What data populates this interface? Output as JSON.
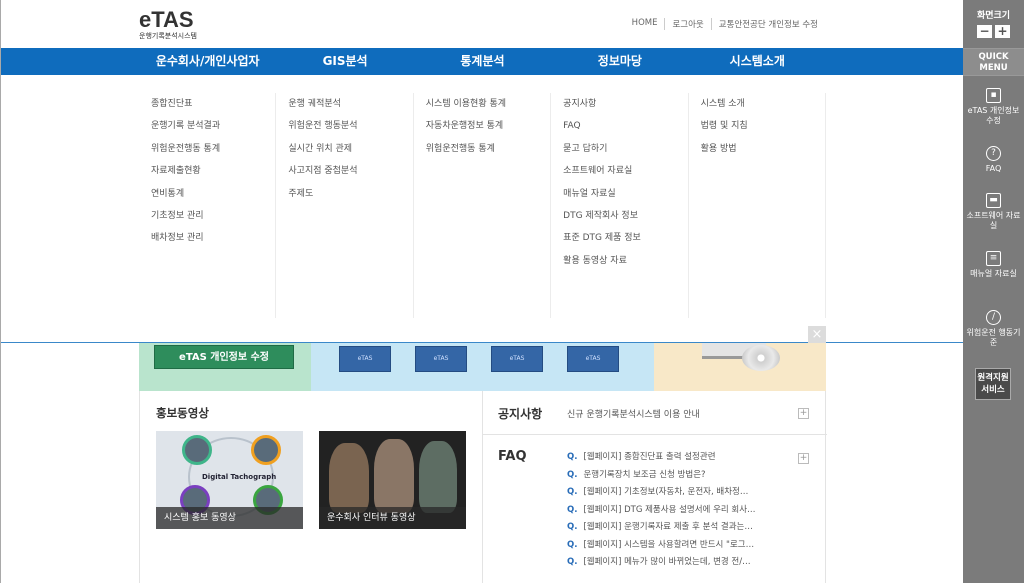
{
  "header": {
    "logo_main": "eTAS",
    "logo_sub": "운행기록분석시스템",
    "util": [
      "HOME",
      "로그아웃",
      "교통안전공단 개인정보 수정"
    ]
  },
  "gnb": [
    "운수회사/개인사업자",
    "GIS분석",
    "통계분석",
    "정보마당",
    "시스템소개"
  ],
  "mega_menu": [
    [
      "종합진단표",
      "운행기록 분석결과",
      "위험운전행동 통계",
      "자료제출현황",
      "연비통계",
      "기초정보 관리",
      "배차정보 관리"
    ],
    [
      "운행 궤적분석",
      "위험운전 행동분석",
      "실시간 위치 관제",
      "사고지점 중첩분석",
      "주제도"
    ],
    [
      "시스템 이용현황 통계",
      "자동차운행정보 통계",
      "위험운전행동 통계"
    ],
    [
      "공지사항",
      "FAQ",
      "묻고 답하기",
      "소프트웨어 자료실",
      "매뉴얼 자료실",
      "DTG 제작회사 정보",
      "표준 DTG 제품 정보",
      "활용 동영상 자료"
    ],
    [
      "시스템 소개",
      "법령 및 지침",
      "활용 방법"
    ]
  ],
  "close_label": "×",
  "banner": {
    "privacy_btn": "eTAS 개인정보 수정",
    "book_label": "eTAS"
  },
  "promo": {
    "title": "홍보동영상",
    "video1_caption": "시스템 홍보 동영상",
    "video1_text": "Digital Tachograph",
    "video2_caption": "운수회사 인터뷰 동영상"
  },
  "notice": {
    "title": "공지사항",
    "text": "신규 운행기록분석시스템 이용 안내"
  },
  "faq": {
    "title": "FAQ",
    "q_mark": "Q.",
    "items": [
      "[웹페이지] 종합진단표 출력 설정관련",
      "운행기록장치 보조금 신청 방법은?",
      "[웹페이지] 기초정보(자동차, 운전자, 배차정…",
      "[웹페이지] DTG 제품사용 설명서에 우리 회사…",
      "[웹페이지] 운행기록자료 제출 후 분석 결과는…",
      "[웹페이지] 시스템을 사용할려면 반드시 \"로그…",
      "[웹페이지] 메뉴가 많이 바뀌었는데, 변경 전/…"
    ]
  },
  "quick": {
    "zoom_title": "화면크기",
    "zoom_minus": "−",
    "zoom_plus": "+",
    "menu_label": "QUICK MENU",
    "items": [
      "eTAS 개인정보 수정",
      "FAQ",
      "소프트웨어 자료실",
      "매뉴얼 자료실",
      "위험운전 행동기준"
    ],
    "remote": "원격지원 서비스"
  }
}
